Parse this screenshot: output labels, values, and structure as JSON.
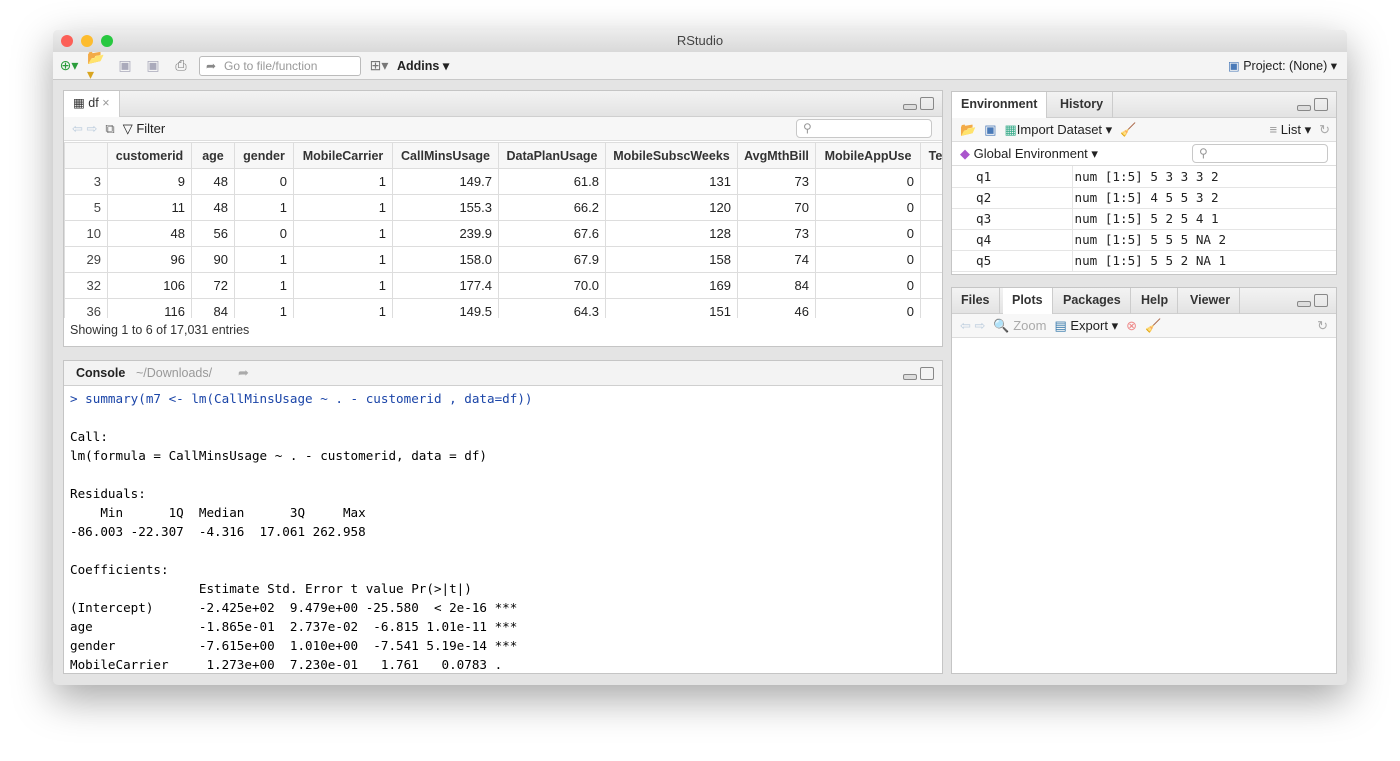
{
  "window": {
    "title": "RStudio"
  },
  "toolbar": {
    "goto_placeholder": "Go to file/function",
    "addins": "Addins",
    "project": "Project: (None)"
  },
  "data_viewer": {
    "tab": "df",
    "filter": "Filter",
    "columns": [
      "",
      "customerid",
      "age",
      "gender",
      "MobileCarrier",
      "CallMinsUsage",
      "DataPlanUsage",
      "MobileSubscWeeks",
      "AvgMthBill",
      "MobileAppUse",
      "Te"
    ],
    "rows": [
      [
        "3",
        "9",
        "48",
        "0",
        "1",
        "149.7",
        "61.8",
        "131",
        "73",
        "0",
        ""
      ],
      [
        "5",
        "11",
        "48",
        "1",
        "1",
        "155.3",
        "66.2",
        "120",
        "70",
        "0",
        ""
      ],
      [
        "10",
        "48",
        "56",
        "0",
        "1",
        "239.9",
        "67.6",
        "128",
        "73",
        "0",
        ""
      ],
      [
        "29",
        "96",
        "90",
        "1",
        "1",
        "158.0",
        "67.9",
        "158",
        "74",
        "0",
        ""
      ],
      [
        "32",
        "106",
        "72",
        "1",
        "1",
        "177.4",
        "70.0",
        "169",
        "84",
        "0",
        ""
      ],
      [
        "36",
        "116",
        "84",
        "1",
        "1",
        "149.5",
        "64.3",
        "151",
        "46",
        "0",
        ""
      ]
    ],
    "footer": "Showing 1 to 6 of 17,031 entries"
  },
  "console": {
    "title": "Console",
    "path": "~/Downloads/",
    "command": "> summary(m7 <- lm(CallMinsUsage ~ . - customerid , data=df))",
    "output": [
      "",
      "Call:",
      "lm(formula = CallMinsUsage ~ . - customerid, data = df)",
      "",
      "Residuals:",
      "    Min      1Q  Median      3Q     Max ",
      "-86.003 -22.307  -4.316  17.061 262.958 ",
      "",
      "Coefficients:",
      "                 Estimate Std. Error t value Pr(>|t|)    ",
      "(Intercept)      -2.425e+02  9.479e+00 -25.580  < 2e-16 ***",
      "age              -1.865e-01  2.737e-02  -6.815 1.01e-11 ***",
      "gender           -7.615e+00  1.010e+00  -7.541 5.19e-14 ***",
      "MobileCarrier     1.273e+00  7.230e-01   1.761   0.0783 .  "
    ]
  },
  "environment": {
    "tabs": [
      "Environment",
      "History"
    ],
    "import": "Import Dataset",
    "list": "List",
    "scope": "Global Environment",
    "vars": [
      [
        "q1",
        "num [1:5] 5 3 3 3 2"
      ],
      [
        "q2",
        "num [1:5] 4 5 5 3 2"
      ],
      [
        "q3",
        "num [1:5] 5 2 5 4 1"
      ],
      [
        "q4",
        "num [1:5] 5 5 5 NA 2"
      ],
      [
        "q5",
        "num [1:5] 5 5 2 NA 1"
      ]
    ]
  },
  "files_pane": {
    "tabs": [
      "Files",
      "Plots",
      "Packages",
      "Help",
      "Viewer"
    ],
    "zoom": "Zoom",
    "export": "Export"
  }
}
